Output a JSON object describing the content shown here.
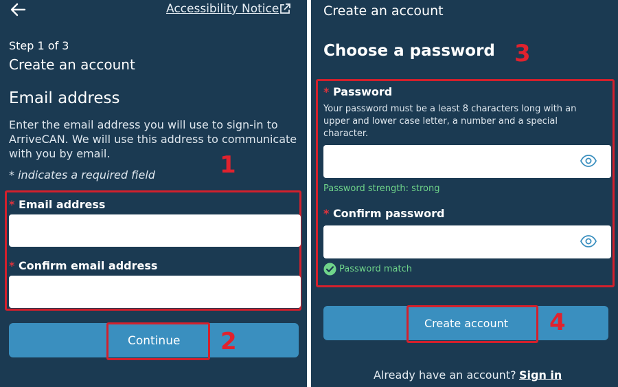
{
  "colors": {
    "panel_bg": "#1b3a52",
    "button_bg": "#3a8fbf",
    "highlight_red": "#d3202c",
    "success_green": "#6fd48a"
  },
  "left": {
    "back_icon": "arrow-left-icon",
    "accessibility_link": "Accessibility Notice",
    "external_icon": "external-link-icon",
    "step": "Step 1 of 3",
    "title": "Create an account",
    "section_heading": "Email address",
    "description_lines": [
      "Enter the email address you will use to sign-in to",
      "ArriveCAN. We will use this address to communicate",
      "with you by email."
    ],
    "required_note": "* indicates a required field",
    "email_label": "Email address",
    "confirm_email_label": "Confirm email address",
    "email_value": "",
    "confirm_email_value": "",
    "continue_button": "Continue",
    "annotation_1": "1",
    "annotation_2": "2"
  },
  "right": {
    "top_title": "Create an account",
    "heading": "Choose a password",
    "password_label": "Password",
    "password_help_lines": [
      "Your password must be a least 8 characters long with an",
      "upper and lower case letter, a number and a special",
      "character."
    ],
    "password_value": "",
    "eye_icon": "eye-icon",
    "strength_text": "Password strength: strong",
    "confirm_password_label": "Confirm password",
    "confirm_password_value": "",
    "match_icon": "check-circle-icon",
    "match_text": "Password match",
    "create_button": "Create account",
    "signin_prompt": "Already have an account?",
    "signin_link": "Sign in",
    "annotation_3": "3",
    "annotation_4": "4"
  }
}
